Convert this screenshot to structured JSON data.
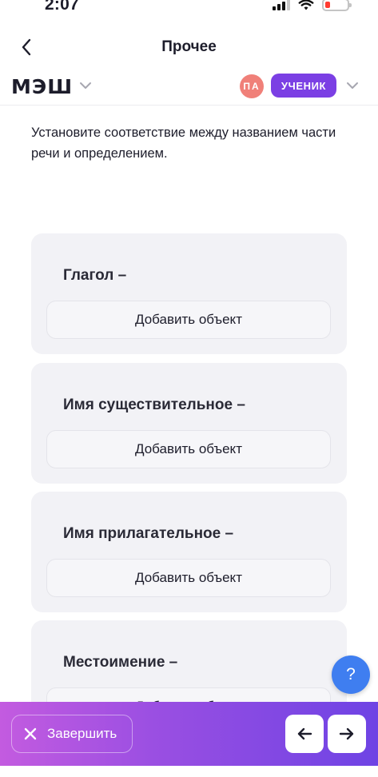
{
  "status": {
    "time": "2:07"
  },
  "nav": {
    "title": "Прочее"
  },
  "brand": {
    "logo": "МЭШ",
    "avatar_initials": "ПА",
    "role": "УЧЕНИК"
  },
  "task": {
    "instruction": "Установите соответствие между названием части речи и определением.",
    "cards": [
      {
        "title": "Глагол –",
        "drop_label": "Добавить объект"
      },
      {
        "title": "Имя существительное –",
        "drop_label": "Добавить объект"
      },
      {
        "title": "Имя прилагательное –",
        "drop_label": "Добавить объект"
      },
      {
        "title": "Местоимение –",
        "drop_label": "Добавить объект"
      }
    ]
  },
  "help": {
    "label": "?"
  },
  "footer": {
    "finish_label": "Завершить"
  },
  "colors": {
    "accent": "#7b3fe4",
    "help": "#3f7ef0",
    "avatar": "#f08079"
  }
}
